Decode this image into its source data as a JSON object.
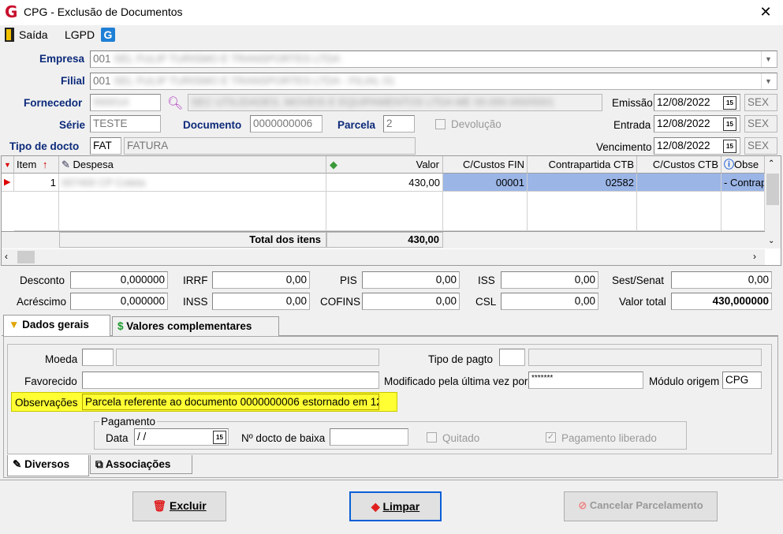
{
  "window": {
    "title": "CPG - Exclusão de Documentos"
  },
  "toolbar": {
    "saida": "Saída",
    "lgpd": "LGPD"
  },
  "header": {
    "empresa_label": "Empresa",
    "empresa_value": "001",
    "filial_label": "Filial",
    "filial_value": "001",
    "fornecedor_label": "Fornecedor",
    "serie_label": "Série",
    "serie_value": "TESTE",
    "documento_label": "Documento",
    "documento_value": "0000000006",
    "parcela_label": "Parcela",
    "parcela_value": "2",
    "devolucao_label": "Devolução",
    "tipo_label": "Tipo de docto",
    "tipo_code": "FAT",
    "tipo_desc": "FATURA",
    "emissao_label": "Emissão",
    "emissao_value": "12/08/2022",
    "emissao_dow": "SEX",
    "entrada_label": "Entrada",
    "entrada_value": "12/08/2022",
    "entrada_dow": "SEX",
    "vencimento_label": "Vencimento",
    "vencimento_value": "12/08/2022",
    "vencimento_dow": "SEX"
  },
  "grid": {
    "columns": [
      "Item",
      "Despesa",
      "Valor",
      "C/Custos FIN",
      "Contrapartida CTB",
      "C/Custos CTB",
      "Obse"
    ],
    "row": {
      "item": "1",
      "valor": "430,00",
      "ccfin": "00001",
      "contrapartida": "02582",
      "ccctb": "",
      "obs": "- Contrap"
    },
    "total_label": "Total dos itens",
    "total_value": "430,00"
  },
  "totals": {
    "desconto_label": "Desconto",
    "desconto": "0,000000",
    "acrescimo_label": "Acréscimo",
    "acrescimo": "0,000000",
    "irrf_label": "IRRF",
    "irrf": "0,00",
    "inss_label": "INSS",
    "inss": "0,00",
    "pis_label": "PIS",
    "pis": "0,00",
    "cofins_label": "COFINS",
    "cofins": "0,00",
    "iss_label": "ISS",
    "iss": "0,00",
    "csl_label": "CSL",
    "csl": "0,00",
    "sest_label": "Sest/Senat",
    "sest": "0,00",
    "valor_total_label": "Valor total",
    "valor_total": "430,000000"
  },
  "tabs": {
    "dados_gerais": "Dados gerais",
    "valores_complementares": "Valores complementares",
    "diversos": "Diversos",
    "associacoes": "Associações"
  },
  "dados": {
    "moeda_label": "Moeda",
    "tipo_pagto_label": "Tipo de pagto",
    "favorecido_label": "Favorecido",
    "modificado_label": "Modificado pela última vez por",
    "modificado_value": "*******",
    "modulo_label": "Módulo origem",
    "modulo_value": "CPG",
    "obs_label": "Observações",
    "obs_value": "Parcela referente ao documento 0000000006 estornado em 12",
    "pagamento_label": "Pagamento",
    "data_label": "Data",
    "data_value": " /  /",
    "ndocto_label": "Nº docto de baixa",
    "quitado_label": "Quitado",
    "pagamento_liberado_label": "Pagamento liberado"
  },
  "buttons": {
    "excluir": "Excluir",
    "limpar": "Limpar",
    "cancelar": "Cancelar Parcelamento"
  },
  "colors": {
    "accent": "#0c2a7a",
    "selection": "#9bb5e6",
    "highlight": "#ffff33",
    "logo": "#c8102e"
  }
}
